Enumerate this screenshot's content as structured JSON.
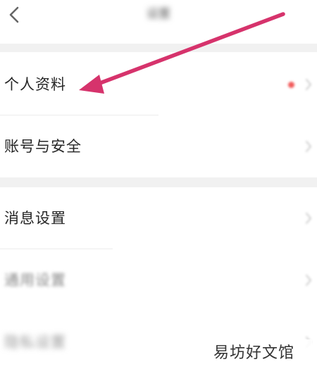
{
  "header": {
    "title": "设置"
  },
  "sections": [
    {
      "items": [
        {
          "label": "个人资料",
          "has_badge": true
        },
        {
          "label": "账号与安全",
          "has_badge": false
        }
      ]
    },
    {
      "items": [
        {
          "label": "消息设置"
        },
        {
          "label": "通用设置"
        },
        {
          "label": "隐私设置"
        }
      ]
    }
  ],
  "annotation": {
    "arrow_color": "#d6336c",
    "target": "个人资料"
  },
  "watermark": {
    "text": "易坊好文馆"
  },
  "colors": {
    "background": "#ffffff",
    "section_gap": "#f1f1f1",
    "badge": "#f15a5a"
  }
}
